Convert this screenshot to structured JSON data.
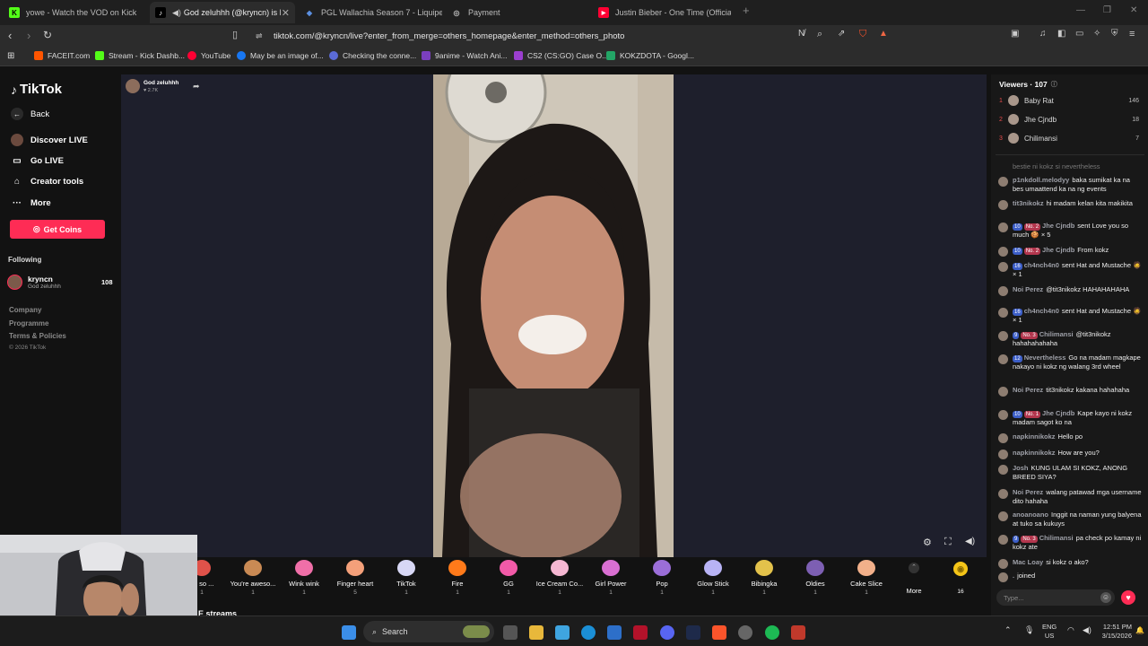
{
  "tabs": [
    {
      "label": "yowe - Watch the VOD on Kick",
      "color": "#53fc18",
      "glyph": "K"
    },
    {
      "label": "God zeluhhh (@kryncn) is LIV",
      "color": "#000000",
      "glyph": "♪"
    },
    {
      "label": "PGL Wallachia Season 7 - Liquipedia",
      "color": "#2f5fb3",
      "glyph": "◆"
    },
    {
      "label": "Payment",
      "color": "#888888",
      "glyph": "◎"
    },
    {
      "label": "Justin Bieber - One Time (Official Mu",
      "color": "#ff0033",
      "glyph": "▶"
    }
  ],
  "url": "tiktok.com/@kryncn/live?enter_from_merge=others_homepage&enter_method=others_photo",
  "bookmarks": [
    {
      "label": "FACEIT.com",
      "color": "#ff5500"
    },
    {
      "label": "Stream - Kick Dashb...",
      "color": "#53fc18"
    },
    {
      "label": "YouTube",
      "color": "#ff0033"
    },
    {
      "label": "May be an image of...",
      "color": "#1877f2"
    },
    {
      "label": "Checking the conne...",
      "color": "#5b6bd6"
    },
    {
      "label": "9anime - Watch Ani...",
      "color": "#7b3fbf"
    },
    {
      "label": "CS2 (CS:GO) Case O...",
      "color": "#9b3fcf"
    },
    {
      "label": "KOKZDOTA - Googl...",
      "color": "#23a566"
    }
  ],
  "sidebar": {
    "logo": "TikTok",
    "back": "Back",
    "items": [
      "Discover LIVE",
      "Go LIVE",
      "Creator tools",
      "More"
    ],
    "get_coins": "Get Coins",
    "following_label": "Following",
    "following_user": {
      "name": "kryncn",
      "sub": "God zeluhhh",
      "count": "108"
    },
    "footer": [
      "Company",
      "Programme",
      "Terms & Policies",
      "© 2026 TikTok"
    ]
  },
  "host": {
    "name": "God zeluhhh",
    "likes": "2.7K"
  },
  "gifts": [
    {
      "label": "ou so ...",
      "cost": "1",
      "color": "#e0524a"
    },
    {
      "label": "You're aweso...",
      "cost": "1",
      "color": "#c98a54"
    },
    {
      "label": "Wink wink",
      "cost": "1",
      "color": "#f06fa8"
    },
    {
      "label": "Finger heart",
      "cost": "5",
      "color": "#f4a07a"
    },
    {
      "label": "TikTok",
      "cost": "1",
      "color": "#d7d7f5"
    },
    {
      "label": "Fire",
      "cost": "1",
      "color": "#ff7a1a"
    },
    {
      "label": "GG",
      "cost": "1",
      "color": "#f25aa8"
    },
    {
      "label": "Ice Cream Co...",
      "cost": "1",
      "color": "#f5b7d2"
    },
    {
      "label": "Girl Power",
      "cost": "1",
      "color": "#d96fd2"
    },
    {
      "label": "Pop",
      "cost": "1",
      "color": "#9b6ed8"
    },
    {
      "label": "Glow Stick",
      "cost": "1",
      "color": "#b8b3f5"
    },
    {
      "label": "Bibingka",
      "cost": "1",
      "color": "#e3c24b"
    },
    {
      "label": "Oldies",
      "cost": "1",
      "color": "#7d5fb3"
    },
    {
      "label": "Cake Slice",
      "cost": "1",
      "color": "#f2b08a"
    }
  ],
  "more_label": "More",
  "coin_count": "16",
  "live_streams_partial": "E streams",
  "viewers": {
    "title": "Viewers · 107",
    "top": [
      {
        "rank": "1",
        "name": "Baby Rat",
        "count": "146"
      },
      {
        "rank": "2",
        "name": "Jhe Cjndb",
        "count": "18"
      },
      {
        "rank": "3",
        "name": "Chilimansi",
        "count": "7"
      }
    ]
  },
  "chat": [
    {
      "user": "",
      "text": "bestie ni kokz si nevertheless",
      "faded": true
    },
    {
      "user": "p1nkdoll.melodyy",
      "text": "baka sumikat ka na bes umaattend ka na ng events"
    },
    {
      "user": "tit3nikokz",
      "text": "hi madam kelan kita makikita"
    },
    {
      "user": "Jhe Cjndb",
      "badge1": "10",
      "badge2": "No. 2",
      "text": "sent Love you so much 🍪 × 5"
    },
    {
      "user": "Jhe Cjndb",
      "badge1": "10",
      "badge2": "No. 2",
      "text": "From kokz"
    },
    {
      "user": "ch4nch4n0",
      "badge1": "16",
      "text": "sent Hat and Mustache 🧔 × 1"
    },
    {
      "user": "Noi Perez",
      "text": "@tit3nikokz HAHAHAHAHA"
    },
    {
      "user": "ch4nch4n0",
      "badge1": "16",
      "text": "sent Hat and Mustache 🧔 × 1"
    },
    {
      "user": "Chilimansi",
      "badge1": "9",
      "badge2": "No. 3",
      "text": "@tit3nikokz hahahahahaha"
    },
    {
      "user": "Nevertheless",
      "badge1": "12",
      "text": "Go na madam magkape nakayo ni kokz ng walang 3rd wheel"
    },
    {
      "user": "Noi Perez",
      "text": "tit3nikokz kakana hahahaha"
    },
    {
      "user": "Jhe Cjndb",
      "badge1": "10",
      "badge2": "No. 1",
      "text": "Kape kayo ni kokz madam sagot ko na"
    },
    {
      "user": "napkinnikokz",
      "text": "Hello po"
    },
    {
      "user": "napkinnikokz",
      "text": "How are you?"
    },
    {
      "user": "Josh",
      "text": "KUNG ULAM SI KOKZ, ANONG BREED SIYA?"
    },
    {
      "user": "Noi Perez",
      "text": "walang patawad mga username dito hahaha"
    },
    {
      "user": "anoanoano",
      "text": "Inggit na naman yung balyena at tuko sa kukuys"
    },
    {
      "user": "Chilimansi",
      "badge1": "9",
      "badge2": "No. 3",
      "text": "pa check po kamay ni kokz ate"
    },
    {
      "user": "Mac Loay",
      "text": "si kokz o ako?"
    },
    {
      "user": ".",
      "text": "joined"
    }
  ],
  "chat_input_placeholder": "Type...",
  "taskbar": {
    "search": "Search",
    "lang1": "ENG",
    "lang2": "US",
    "time": "12:51 PM",
    "date": "3/15/2026"
  }
}
